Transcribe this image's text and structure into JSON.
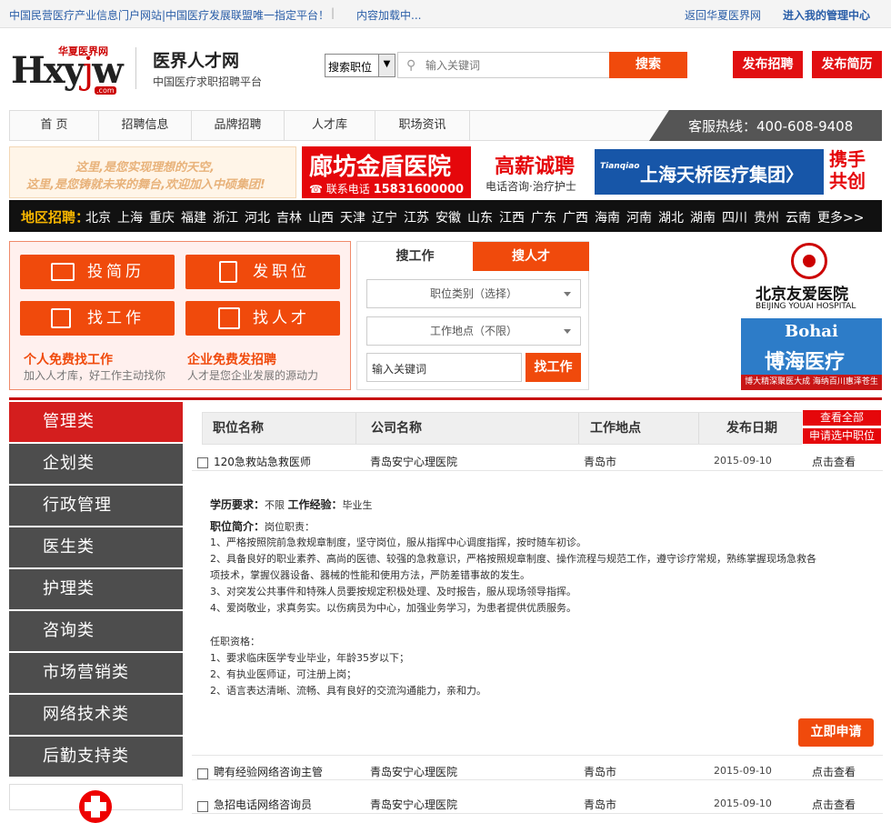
{
  "topbar": {
    "slogan": "中国民营医疗产业信息门户网站|中国医疗发展联盟唯一指定平台！",
    "separator": "|",
    "loading": "内容加载中...",
    "back": "返回华夏医界网",
    "manage": "进入我的管理中心"
  },
  "logo": {
    "cn": "华夏医界网",
    "en_pre": "Hxy",
    "en_mid": "j",
    "en_post": "w",
    "com": ".com"
  },
  "brand": {
    "title": "医界人才网",
    "subtitle": "中国医疗求职招聘平台"
  },
  "search": {
    "select": "搜索职位",
    "placeholder": "输入关键词",
    "button": "搜索"
  },
  "header_buttons": {
    "post_job": "发布招聘",
    "post_resume": "发布简历"
  },
  "nav": {
    "items": [
      "首 页",
      "招聘信息",
      "品牌招聘",
      "人才库",
      "职场资讯"
    ],
    "hotline": "客服热线：400-608-9408"
  },
  "ads": {
    "ad1_line1": "这里,是您实现理想的天空,",
    "ad1_line2": "这里,是您铸就未来的舞台,欢迎加入中硕集团!",
    "ad2_name": "廊坊金盾医院",
    "ad2_phone_label": "☎ 联系电话",
    "ad2_phone": "15831600000",
    "ad2_right_title": "高薪诚聘",
    "ad2_right_sub": "电话咨询·治疗护士",
    "ad3_logo": "Tianqiao",
    "ad3_name": "上海天桥医疗集团〉",
    "ad3_right1": "携手",
    "ad3_right2": "共创"
  },
  "region": {
    "label": "地区招聘：",
    "cities": [
      "北京",
      "上海",
      "重庆",
      "福建",
      "浙江",
      "河北",
      "吉林",
      "山西",
      "天津",
      "辽宁",
      "江苏",
      "安徽",
      "山东",
      "江西",
      "广东",
      "广西",
      "海南",
      "河南",
      "湖北",
      "湖南",
      "四川",
      "贵州",
      "云南",
      "更多>>"
    ]
  },
  "actions": {
    "resume": "投简历",
    "post": "发职位",
    "find_job": "找工作",
    "find_talent": "找人才",
    "personal_title": "个人免费找工作",
    "personal_sub": "加入人才库，好工作主动找你",
    "company_title": "企业免费发招聘",
    "company_sub": "人才是您企业发展的源动力"
  },
  "job_search": {
    "tab_job": "搜工作",
    "tab_talent": "搜人才",
    "category": "职位类别（选择）",
    "location": "工作地点（不限）",
    "keyword": "输入关键词",
    "button": "找工作"
  },
  "side_ads": {
    "youai_cn": "北京友爱医院",
    "youai_en": "BEIJING YOUAI HOSPITAL",
    "bohai_en": "Bohai",
    "bohai_cn": "博海医疗",
    "bohai_footer": "博大精深聚医大成 海纳百川惠泽苍生"
  },
  "categories": [
    "管理类",
    "企划类",
    "行政管理",
    "医生类",
    "护理类",
    "咨询类",
    "市场营销类",
    "网络技术类",
    "后勤支持类"
  ],
  "table": {
    "headers": [
      "职位名称",
      "公司名称",
      "工作地点",
      "发布日期"
    ],
    "view_all": "查看全部",
    "apply_selected": "申请选中职位",
    "rows": [
      {
        "title": "120急救站急救医师",
        "company": "青岛安宁心理医院",
        "location": "青岛市",
        "date": "2015-09-10",
        "action": "点击查看"
      },
      {
        "title": "聘有经验网络咨询主管",
        "company": "青岛安宁心理医院",
        "location": "青岛市",
        "date": "2015-09-10",
        "action": "点击查看"
      },
      {
        "title": "急招电话网络咨询员",
        "company": "青岛安宁心理医院",
        "location": "青岛市",
        "date": "2015-09-10",
        "action": "点击查看"
      }
    ]
  },
  "detail": {
    "edu_label": "学历要求：",
    "edu_value": "不限",
    "exp_label": "工作经验：",
    "exp_value": "毕业生",
    "intro_label": "职位简介：",
    "intro_value": "岗位职责：",
    "lines": [
      "1、严格按照院前急救规章制度，坚守岗位，服从指挥中心调度指挥，按时随车初诊。",
      "2、具备良好的职业素养、高尚的医德、较强的急救意识，严格按照规章制度、操作流程与规范工作，遵守诊疗常规，熟练掌握现场急救各",
      "项技术，掌握仪器设备、器械的性能和使用方法，严防差错事故的发生。",
      "3、对突发公共事件和特殊人员要按规定积极处理、及时报告，服从现场领导指挥。",
      "4、爱岗敬业，求真务实。以伤病员为中心，加强业务学习，为患者提供优质服务。",
      "任职资格：",
      "1、要求临床医学专业毕业，年龄35岁以下；",
      "2、有执业医师证，可注册上岗；",
      "2、语言表达清晰、流畅、具有良好的交流沟通能力，亲和力。"
    ],
    "apply": "立即申请"
  }
}
